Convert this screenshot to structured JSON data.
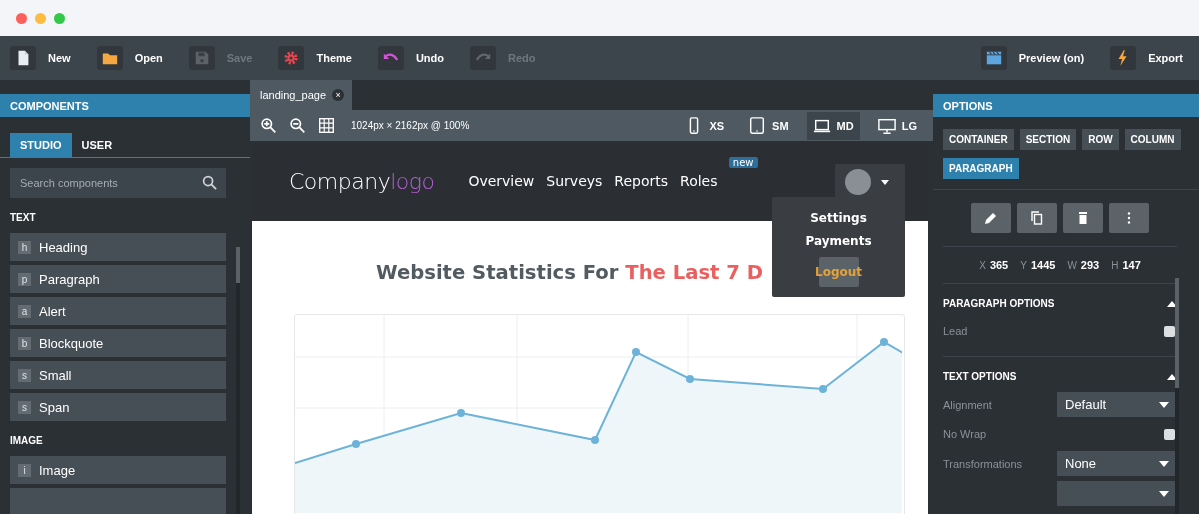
{
  "toolbar": {
    "left": [
      {
        "label": "New",
        "disabled": false
      },
      {
        "label": "Open",
        "disabled": false
      },
      {
        "label": "Save",
        "disabled": true
      },
      {
        "label": "Theme",
        "disabled": false
      },
      {
        "label": "Undo",
        "disabled": false
      },
      {
        "label": "Redo",
        "disabled": true
      }
    ],
    "right": [
      {
        "label": "Preview (on)",
        "disabled": false
      },
      {
        "label": "Export",
        "disabled": false
      }
    ]
  },
  "components": {
    "title": "COMPONENTS",
    "tabs": [
      {
        "label": "STUDIO",
        "selected": true
      },
      {
        "label": "USER",
        "selected": false
      }
    ],
    "search": {
      "placeholder": "Search components"
    },
    "sections": [
      {
        "title": "TEXT",
        "items": [
          {
            "badge": "h",
            "label": "Heading"
          },
          {
            "badge": "p",
            "label": "Paragraph"
          },
          {
            "badge": "a",
            "label": "Alert"
          },
          {
            "badge": "b",
            "label": "Blockquote"
          },
          {
            "badge": "s",
            "label": "Small"
          },
          {
            "badge": "s",
            "label": "Span"
          }
        ]
      },
      {
        "title": "IMAGE",
        "items": [
          {
            "badge": "i",
            "label": "Image"
          }
        ]
      }
    ]
  },
  "editor": {
    "tab": {
      "label": "landing_page",
      "close": "×"
    },
    "info": "1024px × 2162px @ 100%",
    "devices": [
      {
        "label": "XS",
        "selected": false
      },
      {
        "label": "SM",
        "selected": false
      },
      {
        "label": "MD",
        "selected": true
      },
      {
        "label": "LG",
        "selected": false
      }
    ],
    "site": {
      "logo": {
        "main": "Company",
        "accent": "logo"
      },
      "nav": [
        {
          "label": "Overview"
        },
        {
          "label": "Surveys"
        },
        {
          "label": "Reports"
        },
        {
          "label": "Roles",
          "badge": "new"
        }
      ],
      "menu": [
        {
          "label": "Settings",
          "active": false
        },
        {
          "label": "Payments",
          "active": false
        },
        {
          "label": "Logout",
          "active": true
        }
      ],
      "heading": {
        "text": "Website Statistics For",
        "highlight": "The Last 7 D"
      }
    }
  },
  "options": {
    "title": "OPTIONS",
    "breadcrumbs": [
      {
        "label": "CONTAINER",
        "selected": false
      },
      {
        "label": "SECTION",
        "selected": false
      },
      {
        "label": "ROW",
        "selected": false
      },
      {
        "label": "COLUMN",
        "selected": false
      },
      {
        "label": "PARAGRAPH",
        "selected": true
      }
    ],
    "readout": [
      {
        "label": "X",
        "value": "365"
      },
      {
        "label": "Y",
        "value": "1445"
      },
      {
        "label": "W",
        "value": "293"
      },
      {
        "label": "H",
        "value": "147"
      }
    ],
    "sections": [
      {
        "title": "PARAGRAPH OPTIONS",
        "expanded": true,
        "fields": [
          {
            "kind": "checkbox",
            "label": "Lead",
            "checked": false
          }
        ]
      },
      {
        "title": "TEXT OPTIONS",
        "expanded": true,
        "fields": [
          {
            "kind": "select",
            "label": "Alignment",
            "value": "Default"
          },
          {
            "kind": "checkbox",
            "label": "No Wrap",
            "checked": false
          },
          {
            "kind": "select",
            "label": "Transformations",
            "value": "None"
          },
          {
            "kind": "select"
          }
        ]
      }
    ]
  }
}
